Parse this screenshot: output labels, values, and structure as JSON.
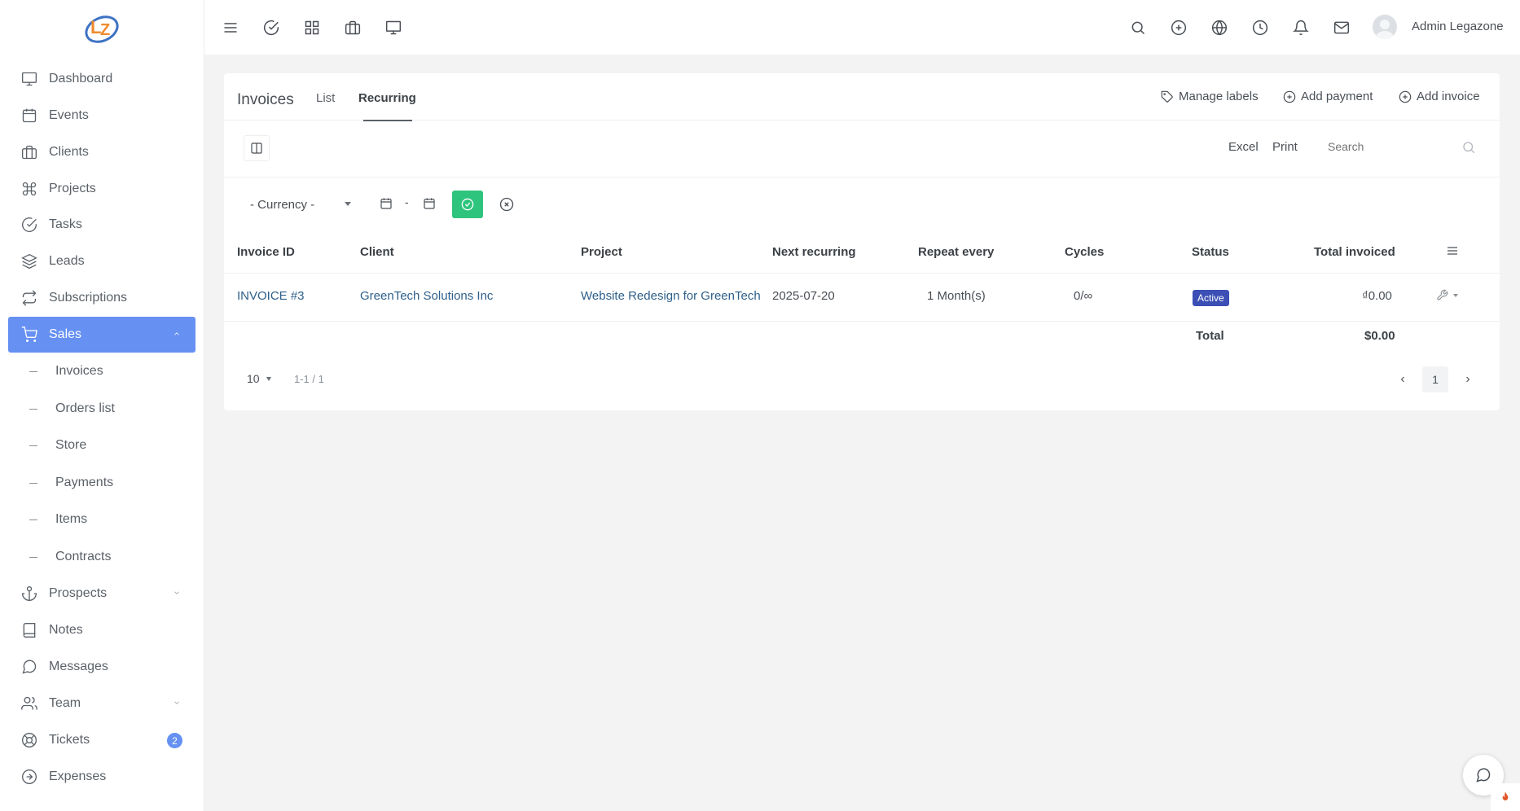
{
  "user": {
    "name": "Admin Legazone"
  },
  "sidebar": {
    "items": [
      {
        "label": "Dashboard",
        "icon": "monitor-icon"
      },
      {
        "label": "Events",
        "icon": "calendar-icon"
      },
      {
        "label": "Clients",
        "icon": "briefcase-icon"
      },
      {
        "label": "Projects",
        "icon": "command-icon"
      },
      {
        "label": "Tasks",
        "icon": "check-circle-icon"
      },
      {
        "label": "Leads",
        "icon": "layers-icon"
      },
      {
        "label": "Subscriptions",
        "icon": "repeat-icon"
      },
      {
        "label": "Sales",
        "icon": "cart-icon",
        "active": true
      },
      {
        "label": "Prospects",
        "icon": "anchor-icon"
      },
      {
        "label": "Notes",
        "icon": "book-icon"
      },
      {
        "label": "Messages",
        "icon": "message-icon"
      },
      {
        "label": "Team",
        "icon": "users-icon"
      },
      {
        "label": "Tickets",
        "icon": "life-buoy-icon",
        "badge": "2"
      },
      {
        "label": "Expenses",
        "icon": "arrow-right-circle-icon"
      }
    ],
    "sales_sub": [
      "Invoices",
      "Orders list",
      "Store",
      "Payments",
      "Items",
      "Contracts"
    ]
  },
  "page": {
    "title": "Invoices",
    "tabs": [
      "List",
      "Recurring"
    ],
    "active_tab": "Recurring",
    "manage_labels": "Manage labels",
    "add_payment": "Add payment",
    "add_invoice": "Add invoice"
  },
  "toolbar": {
    "excel": "Excel",
    "print": "Print",
    "search_placeholder": "Search"
  },
  "filters": {
    "currency": "- Currency -",
    "date_sep": "-"
  },
  "table": {
    "columns": [
      "Invoice ID",
      "Client",
      "Project",
      "Next recurring",
      "Repeat every",
      "Cycles",
      "Status",
      "Total invoiced"
    ],
    "rows": [
      {
        "invoice_id": "INVOICE #3",
        "client": "GreenTech Solutions Inc",
        "project": "Website Redesign for GreenTech",
        "next_recurring": "2025-07-20",
        "repeat_every": "1 Month(s)",
        "cycles": "0/∞",
        "status": "Active",
        "total_invoiced": "₫0.00"
      }
    ],
    "total_label": "Total",
    "total_value": "$0.00"
  },
  "pager": {
    "size": "10",
    "info": "1-1 / 1",
    "current_page": "1"
  },
  "colors": {
    "accent": "#6690f2",
    "apply": "#2ec47d",
    "status_active": "#3b4fb5",
    "link": "#2d5f8a"
  }
}
